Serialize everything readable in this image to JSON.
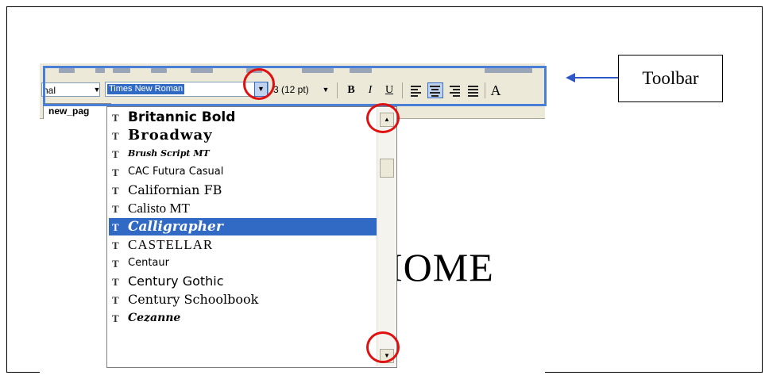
{
  "toolbar": {
    "style_value": "nal",
    "font_value": "Times New Roman",
    "size_value": "3  (12 pt)",
    "bold_label": "B",
    "italic_label": "I",
    "underline_label": "U",
    "extra_label": "A",
    "active_alignment": "center"
  },
  "tab": {
    "label": "new_pag"
  },
  "document": {
    "text": "IOME"
  },
  "font_list": {
    "items": [
      {
        "label": "Britannic Bold"
      },
      {
        "label": "Broadway"
      },
      {
        "label": "Brush Script MT"
      },
      {
        "label": "CAC Futura Casual"
      },
      {
        "label": "Californian FB"
      },
      {
        "label": "Calisto MT"
      },
      {
        "label": "Calligrapher"
      },
      {
        "label": "CASTELLAR"
      },
      {
        "label": "Centaur"
      },
      {
        "label": "Century Gothic"
      },
      {
        "label": "Century Schoolbook"
      },
      {
        "label": "Cezanne"
      }
    ],
    "selected_index": 6,
    "icon_glyph": "T"
  },
  "annotation": {
    "label": "Toolbar"
  },
  "colors": {
    "highlight": "#316ac5",
    "toolbar_border": "#4a7fd8",
    "circle": "#e01010",
    "arrow": "#2f57c8"
  }
}
